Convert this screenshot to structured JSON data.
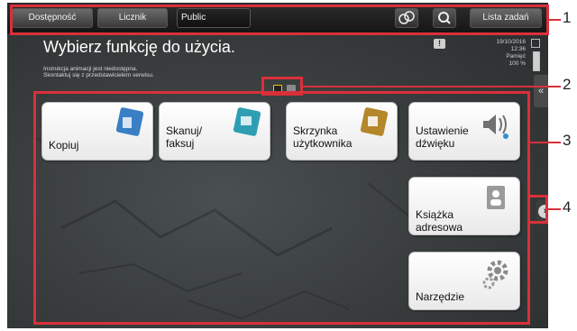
{
  "topbar": {
    "accessibility_label": "Dostępność",
    "counter_label": "Licznik",
    "user_label": "Public",
    "job_list_label": "Lista zadań"
  },
  "header": {
    "title": "Wybierz funkcję do użycia.",
    "notice_line1": "Instrukcja animacji jest niedostępna.",
    "notice_line2": "Skontaktuj się z przedstawicielem serwisu.",
    "warning_symbol": "!",
    "date": "19/10/2016",
    "time": "12:36",
    "memory_label": "Pamięć",
    "memory_value": "100 %",
    "memory_level": 1.0
  },
  "pager": {
    "current_page": 1,
    "total_pages": 2
  },
  "tiles": [
    {
      "line1": "Kopiuj",
      "line2": "",
      "icon": "copy-icon",
      "color": "#3a7fc4"
    },
    {
      "line1": "Skanuj/",
      "line2": "faksuj",
      "icon": "scan-fax-icon",
      "color": "#2e9fb3"
    },
    {
      "line1": "Skrzynka",
      "line2": "użytkownika",
      "icon": "user-box-icon",
      "color": "#b4882a"
    },
    {
      "line1": "Ustawienie",
      "line2": "dźwięku",
      "icon": "sound-icon",
      "color": "#707070"
    },
    {
      "line1": "Książka",
      "line2": "adresowa",
      "icon": "address-book-icon",
      "color": "#808080"
    },
    {
      "line1": "Narzędzie",
      "line2": "",
      "icon": "gear-icon",
      "color": "#888888"
    }
  ],
  "callouts": [
    "1",
    "2",
    "3",
    "4"
  ],
  "colors": {
    "callout": "#d9303a",
    "active_page": "#e8c800"
  }
}
